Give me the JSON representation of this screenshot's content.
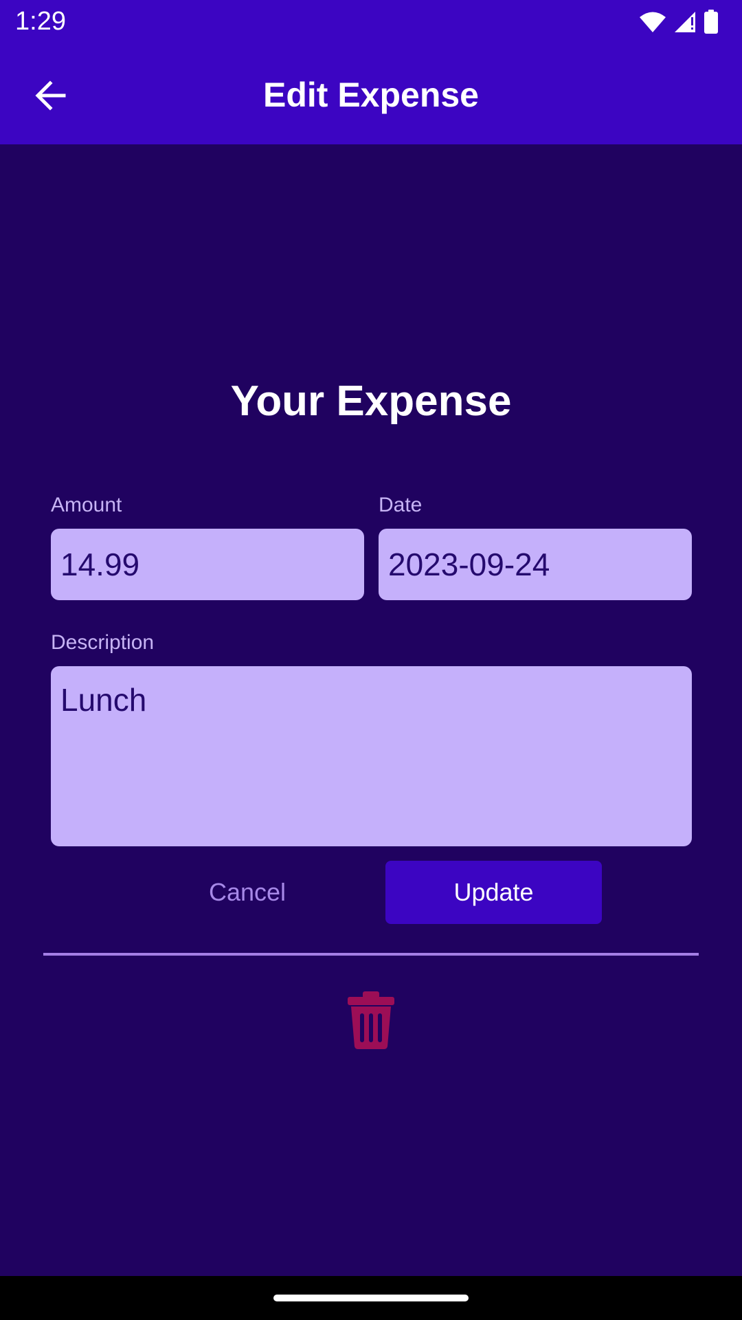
{
  "status_bar": {
    "time": "1:29",
    "icons": [
      "wifi-icon",
      "signal-icon",
      "battery-icon"
    ]
  },
  "app_bar": {
    "back_icon": "arrow-left-icon",
    "title": "Edit Expense"
  },
  "form": {
    "heading": "Your Expense",
    "amount": {
      "label": "Amount",
      "value": "14.99"
    },
    "date": {
      "label": "Date",
      "value": "2023-09-24"
    },
    "description": {
      "label": "Description",
      "value": "Lunch"
    }
  },
  "actions": {
    "cancel_label": "Cancel",
    "update_label": "Update",
    "delete_icon": "trash-icon"
  },
  "colors": {
    "header": "#3c05c2",
    "background": "#200260",
    "field_fill": "#c5b0fb",
    "field_text": "#250a6e",
    "label_text": "#c7b4f5",
    "cancel_text": "#a789e8",
    "divider": "#a47ee6",
    "delete_icon": "#9c0e56"
  }
}
